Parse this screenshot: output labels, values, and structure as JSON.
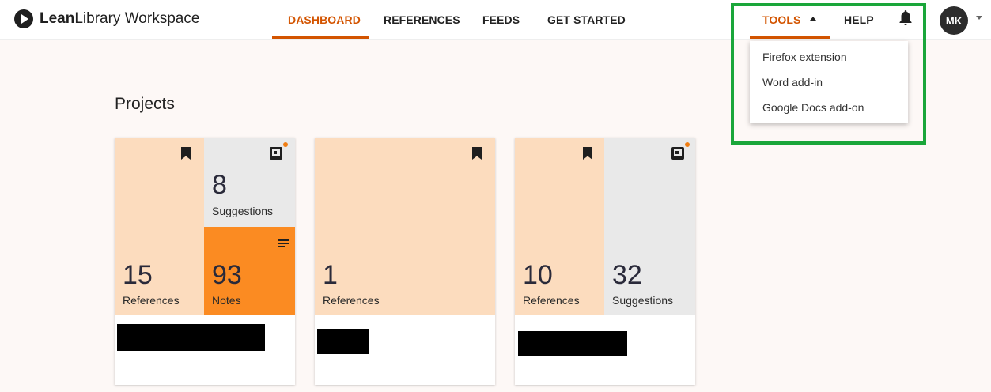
{
  "app": {
    "brand_bold": "Lean",
    "brand_rest": "Library Workspace"
  },
  "nav": {
    "dashboard": "DASHBOARD",
    "references": "REFERENCES",
    "feeds": "FEEDS",
    "get_started": "GET STARTED",
    "tools": "TOOLS",
    "help": "HELP"
  },
  "user": {
    "initials": "MK"
  },
  "tools_menu": {
    "items": [
      "Firefox extension",
      "Word add-in",
      "Google Docs add-on"
    ]
  },
  "projects": {
    "title": "Projects",
    "cards": [
      {
        "references": "15",
        "references_label": "References",
        "suggestions": "8",
        "suggestions_label": "Suggestions",
        "notes": "93",
        "notes_label": "Notes"
      },
      {
        "references": "1",
        "references_label": "References"
      },
      {
        "references": "10",
        "references_label": "References",
        "suggestions": "32",
        "suggestions_label": "Suggestions"
      }
    ]
  },
  "colors": {
    "accent": "#d35400",
    "peach": "#fcdcbe",
    "orange": "#fb8b22",
    "grey": "#e9e9e9",
    "highlight": "#1aa63a"
  }
}
